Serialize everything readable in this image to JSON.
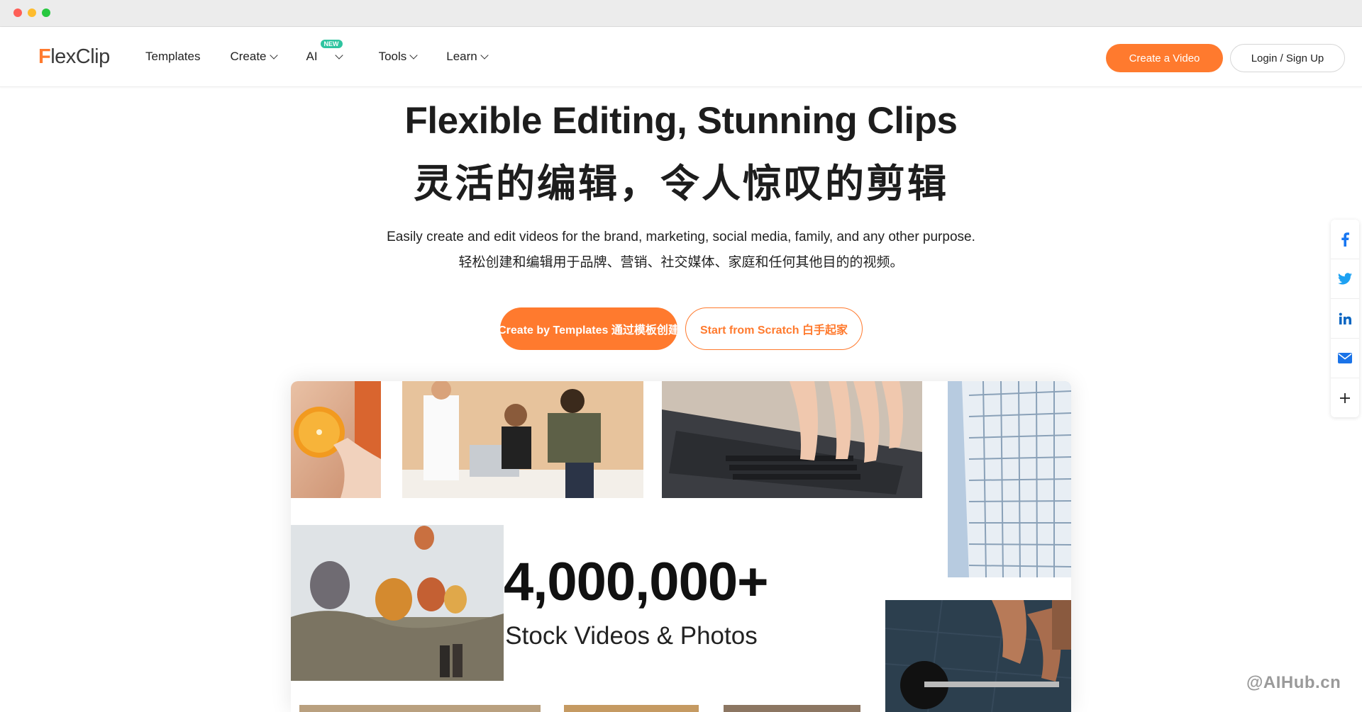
{
  "window": {
    "title": ""
  },
  "header": {
    "logo_text_f": "F",
    "logo_text_rest": "lexClip",
    "nav": [
      {
        "label": "Templates",
        "dropdown": false
      },
      {
        "label": "Create",
        "dropdown": true
      },
      {
        "label": "AI",
        "dropdown": true,
        "badge": "NEW"
      },
      {
        "label": "Tools",
        "dropdown": true
      },
      {
        "label": "Learn",
        "dropdown": true
      }
    ],
    "create_video_label": "Create a Video",
    "login_label": "Login / Sign Up"
  },
  "hero": {
    "title": "Flexible Editing, Stunning Clips",
    "title_cn": "灵活的编辑，令人惊叹的剪辑",
    "subtitle": "Easily create and edit videos for the brand, marketing, social media, family, and any other purpose.",
    "subtitle_cn": "轻松创建和编辑用于品牌、营销、社交媒体、家庭和任何其他目的的视频。",
    "cta_templates": "Create by Templates  通过模板创建",
    "cta_scratch": "Start from Scratch 白手起家"
  },
  "collage": {
    "stat_number": "4,000,000+",
    "stat_caption": "Stock Videos & Photos"
  },
  "share": {
    "items": [
      "facebook-icon",
      "twitter-icon",
      "linkedin-icon",
      "mail-icon",
      "plus-icon"
    ]
  },
  "watermark": "@AIHub.cn",
  "colors": {
    "accent": "#ff7a2e",
    "facebook": "#1877f2",
    "twitter": "#1da1f2",
    "linkedin": "#0a66c2",
    "mail": "#1a73e8",
    "new_badge": "#2ec4a0"
  }
}
